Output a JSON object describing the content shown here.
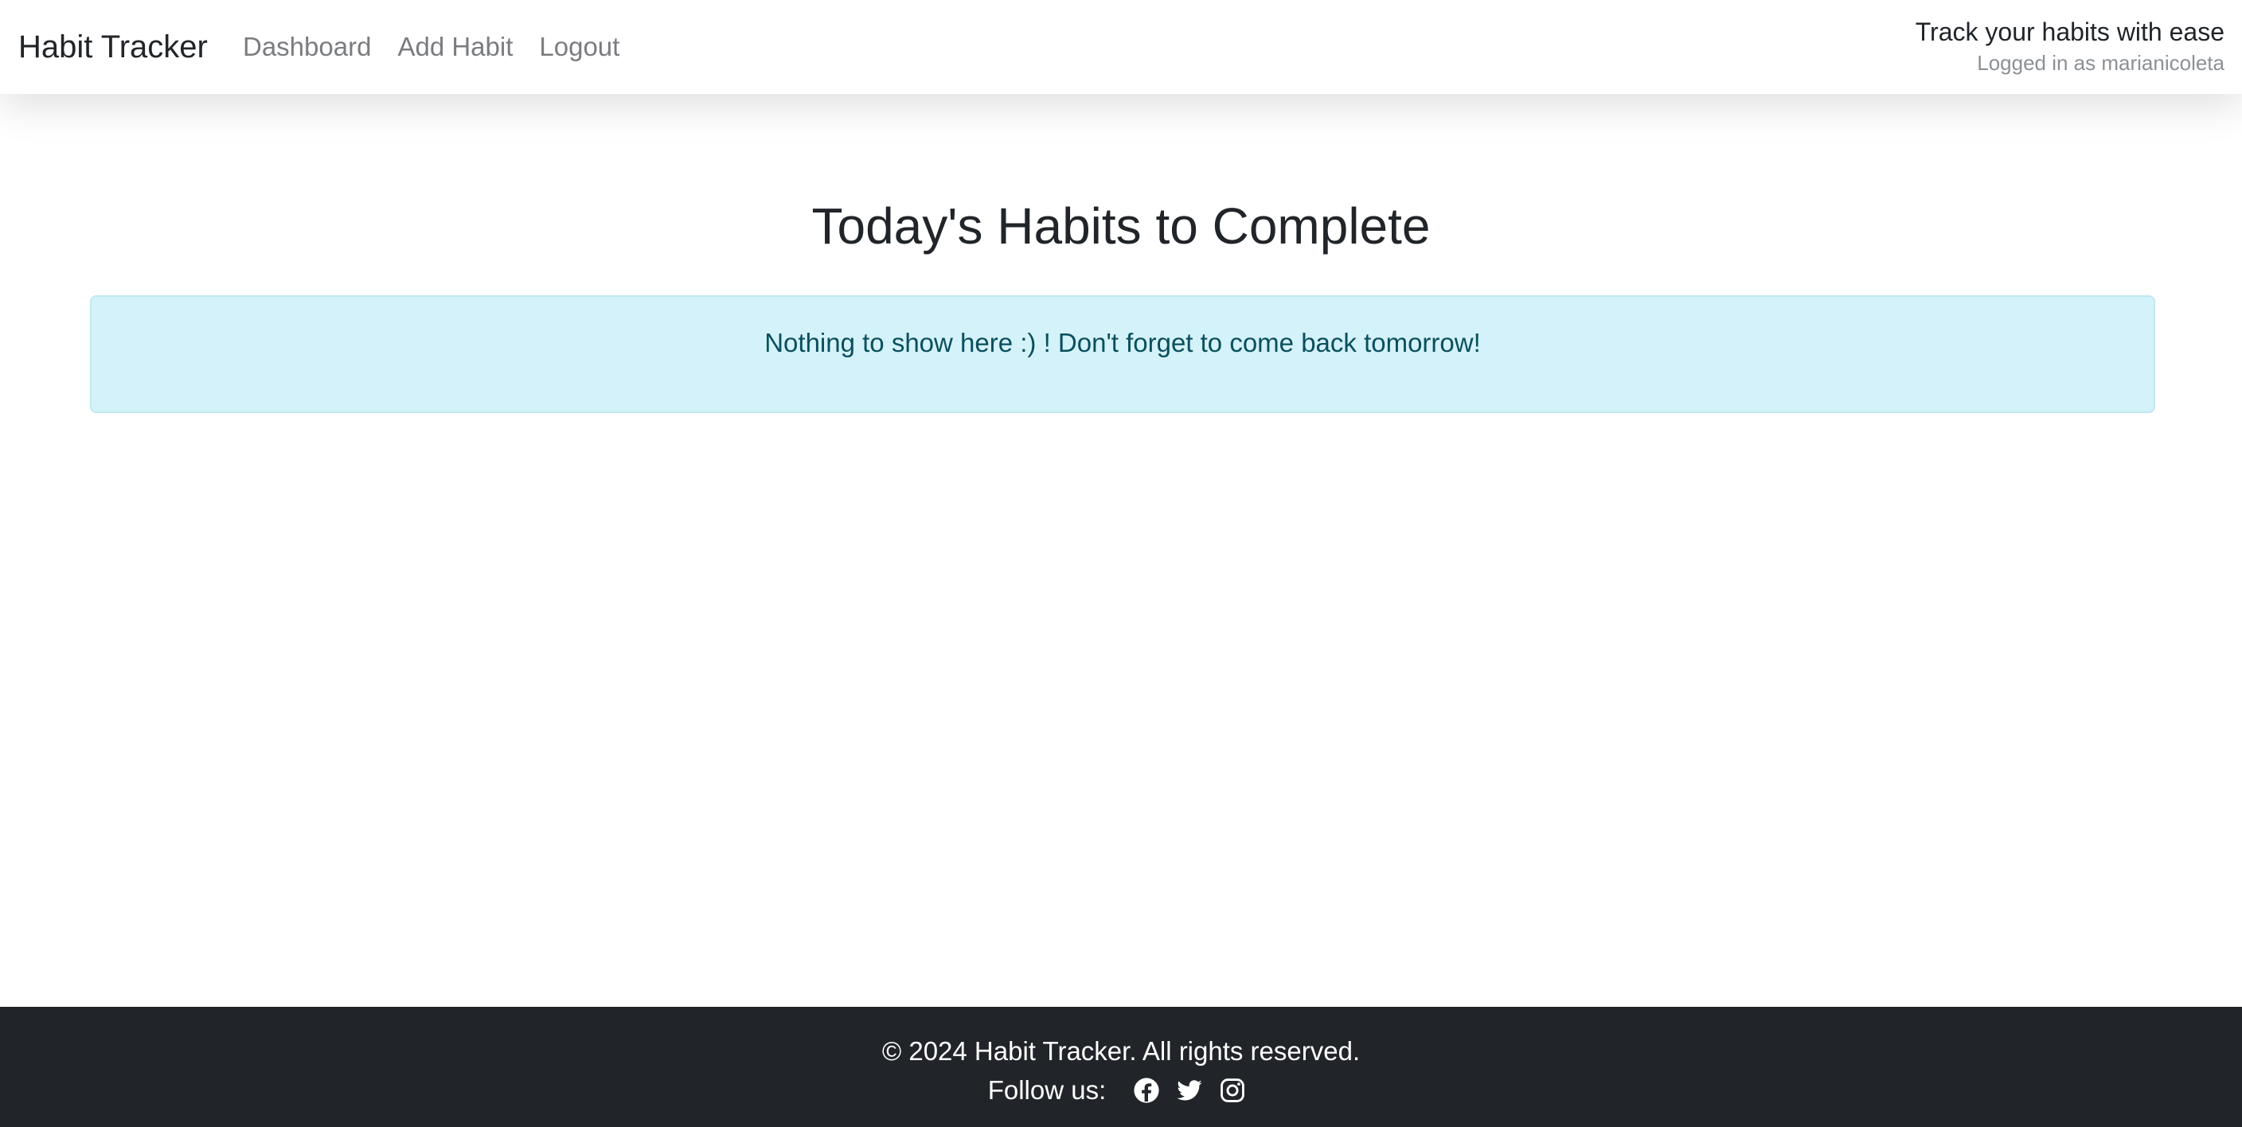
{
  "navbar": {
    "brand": "Habit Tracker",
    "links": [
      "Dashboard",
      "Add Habit",
      "Logout"
    ],
    "tagline": "Track your habits with ease",
    "logged_in": "Logged in as marianicoleta"
  },
  "main": {
    "title": "Today's Habits to Complete",
    "alert_message": "Nothing to show here :) ! Don't forget to come back tomorrow!"
  },
  "footer": {
    "copyright": "© 2024 Habit Tracker. All rights reserved.",
    "follow_label": "Follow us:",
    "social_icons": [
      "facebook-icon",
      "twitter-icon",
      "instagram-icon"
    ]
  },
  "colors": {
    "navbar_bg": "#ffffff",
    "alert_bg": "#d4f2f9",
    "alert_text": "#0a4f5e",
    "footer_bg": "#212529"
  }
}
